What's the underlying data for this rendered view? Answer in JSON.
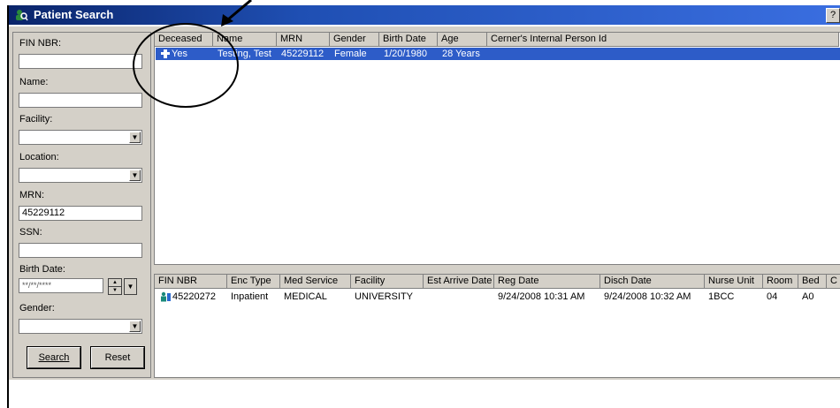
{
  "window": {
    "title": "Patient Search",
    "help": "?"
  },
  "left_panel": {
    "fin_label": "FIN NBR:",
    "fin_value": "",
    "name_label": "Name:",
    "name_value": "",
    "facility_label": "Facility:",
    "facility_value": "",
    "location_label": "Location:",
    "location_value": "",
    "mrn_label": "MRN:",
    "mrn_value": "45229112",
    "ssn_label": "SSN:",
    "ssn_value": "",
    "birth_label": "Birth Date:",
    "birth_value": "**/**/****",
    "gender_label": "Gender:",
    "gender_value": "",
    "search_button": "Search",
    "reset_button": "Reset"
  },
  "person_grid": {
    "headers": [
      "Deceased",
      "Name",
      "MRN",
      "Gender",
      "Birth Date",
      "Age",
      "Cerner's Internal Person Id"
    ],
    "rows": [
      {
        "deceased": "Yes",
        "name": "Testing, Test",
        "mrn": "45229112",
        "gender": "Female",
        "birth_date": "1/20/1980",
        "age": "28 Years",
        "person_id": ""
      }
    ]
  },
  "encounter_grid": {
    "headers": [
      "FIN NBR",
      "Enc Type",
      "Med Service",
      "Facility",
      "Est Arrive Date",
      "Reg Date",
      "Disch Date",
      "Nurse Unit",
      "Room",
      "Bed",
      "C"
    ],
    "rows": [
      {
        "fin": "45220272",
        "enc_type": "Inpatient",
        "med_service": "MEDICAL",
        "facility": "UNIVERSITY",
        "est_arrive": "",
        "reg_date": "9/24/2008 10:31 AM",
        "disch_date": "9/24/2008 10:32 AM",
        "nurse_unit": "1BCC",
        "room": "04",
        "bed": "A0"
      }
    ]
  },
  "colors": {
    "titlebar": "#0a246a",
    "selection": "#2d5cc8",
    "face": "#d4d0c8"
  }
}
